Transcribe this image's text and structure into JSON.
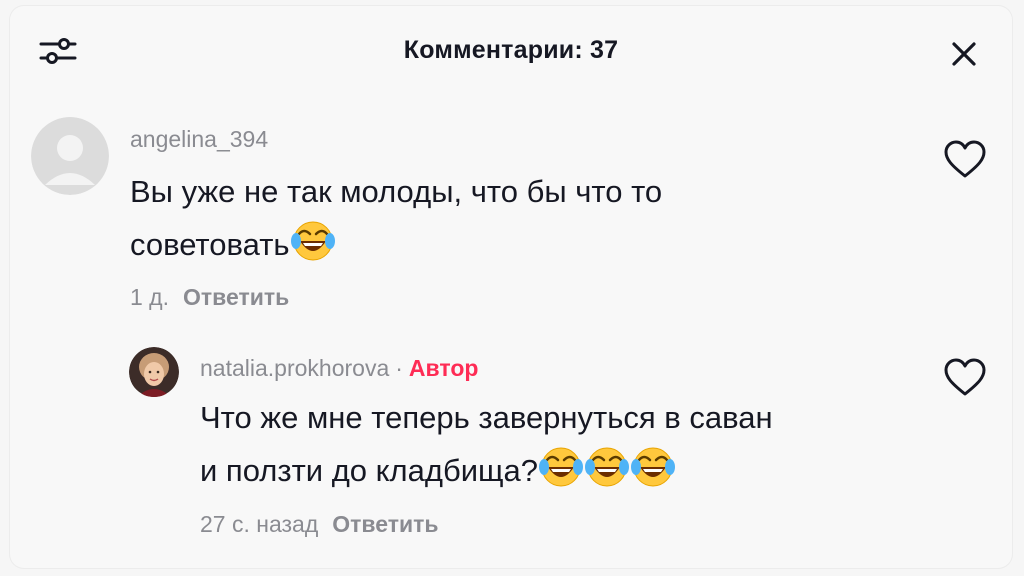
{
  "header": {
    "title": "Комментарии: 37",
    "filter_icon": "sliders-icon",
    "close_icon": "close-icon"
  },
  "comments": [
    {
      "username": "angelina_394",
      "text_line1": "Вы уже не так молоды, что бы что то",
      "text_line2": "советовать",
      "emoji": "face-with-tears-of-joy",
      "time": "1 д.",
      "reply_label": "Ответить"
    }
  ],
  "reply": {
    "username": "natalia.prokhorova",
    "separator": "·",
    "author_badge": "Автор",
    "text_line1": "Что же мне теперь завернуться в саван",
    "text_line2": "и ползти до кладбища?",
    "emoji": "face-with-tears-of-joy",
    "time": "27 с. назад",
    "reply_label": "Ответить"
  },
  "colors": {
    "accent": "#fe2c55",
    "secondary_text": "#8a8b91",
    "primary_text": "#161823"
  }
}
